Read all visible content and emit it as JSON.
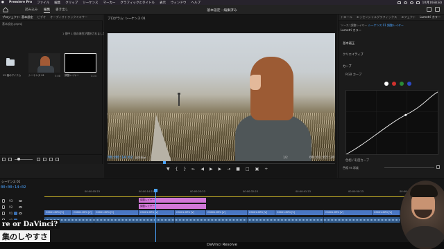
{
  "menubar": {
    "app": "Premiere Pro",
    "items": [
      "ファイル",
      "編集",
      "クリップ",
      "シーケンス",
      "マーカー",
      "グラフィックとタイトル",
      "表示",
      "ウィンドウ",
      "ヘルプ"
    ],
    "clock": "10月16日(日)"
  },
  "header": {
    "tabs": [
      "読み込み",
      "編集",
      "書き出し"
    ],
    "title": "基本設定",
    "title_suffix": "- 編集済み"
  },
  "project": {
    "tabs": [
      "プロジェクト: 基本設定",
      "ビデオ",
      "オーディオトラックミキサー"
    ],
    "path": "基本設定.prproj",
    "selection_info": "1 個中 1 個の項目が選択されました",
    "bins": [
      {
        "label": "12 個のアイテム",
        "count": ""
      },
      {
        "label": "シーケンス 01",
        "count": "5:08"
      },
      {
        "label": "調整レイヤー",
        "count": "4:24"
      }
    ]
  },
  "program": {
    "title": "プログラム: シーケンス 01",
    "timecode_in": "00:00:14:02",
    "zoom_label": "全体表示",
    "full_label": "1/2",
    "timecode_out": "00:01:03:20"
  },
  "lumetri": {
    "tabs": [
      "トロール",
      "エッセンシャルグラフィックス",
      "エフェクト",
      "Lumetri カラー"
    ],
    "source_prefix": "ソース: 調整レイヤー",
    "source_suffix": "シーケンス 01 調整レイヤー",
    "fx_label": "Lumetri カラー",
    "sections": [
      "基本補正",
      "クリエイティブ",
      "カーブ"
    ],
    "rgb_curve_label": "RGB カーブ",
    "hue_sat_label": "色相 / 彩度カーブ",
    "hue_vs_sat_label": "色相 vs 彩度",
    "dot_colors": [
      "#ffffff",
      "#d0312d",
      "#2a8a36",
      "#2d49c7"
    ]
  },
  "timeline": {
    "tab": "シーケンス 01",
    "timecode": "00:00:14:02",
    "ruler_ticks": [
      "00:00:05:23",
      "00:00:14:23",
      "00:00:23:23",
      "00:00:32:23",
      "00:00:41:23",
      "00:00:50:23",
      "00:00:59:22"
    ],
    "tracks": [
      "V3",
      "V2",
      "V1",
      "A1"
    ],
    "adjustment_clips": [
      "調整レイヤー",
      "調整レイヤー"
    ],
    "video_clip_label": "C0001.MP4 [V]"
  },
  "overlay": {
    "line1": "re or DaVinci?",
    "line2": "集のしやすさ"
  },
  "footer": {
    "label": "DaVinci Resolve"
  }
}
